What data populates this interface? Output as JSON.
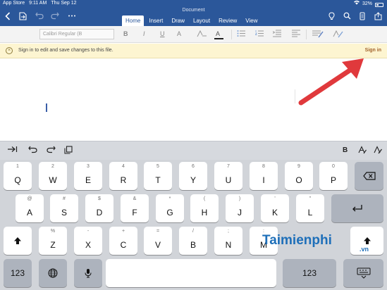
{
  "status_bar": {
    "back_app": "App Store",
    "time": "9:11 AM",
    "date": "Thu Sep 12",
    "battery": "32%"
  },
  "title_bar": {
    "document_title": "Document",
    "tabs": [
      "Home",
      "Insert",
      "Draw",
      "Layout",
      "Review",
      "View"
    ],
    "active_tab": "Home"
  },
  "ribbon": {
    "font_name": "Calibri Regular (B",
    "bold": "B",
    "italic": "I",
    "underline": "U",
    "format_brush": "A",
    "font_color": "A",
    "highlight": "A"
  },
  "signin_bar": {
    "message": "Sign in to edit and save changes to this file.",
    "link": "Sign in",
    "info_icon": "i"
  },
  "keyboard_toolbar": {
    "bold": "B"
  },
  "keyboard": {
    "row1": [
      {
        "main": "Q",
        "sub": "1"
      },
      {
        "main": "W",
        "sub": "2"
      },
      {
        "main": "E",
        "sub": "3"
      },
      {
        "main": "R",
        "sub": "4"
      },
      {
        "main": "T",
        "sub": "5"
      },
      {
        "main": "Y",
        "sub": "6"
      },
      {
        "main": "U",
        "sub": "7"
      },
      {
        "main": "I",
        "sub": "8"
      },
      {
        "main": "O",
        "sub": "9"
      },
      {
        "main": "P",
        "sub": "0"
      }
    ],
    "row2": [
      {
        "main": "A",
        "sub": "@"
      },
      {
        "main": "S",
        "sub": "#"
      },
      {
        "main": "D",
        "sub": "$"
      },
      {
        "main": "F",
        "sub": "&"
      },
      {
        "main": "G",
        "sub": "*"
      },
      {
        "main": "H",
        "sub": "("
      },
      {
        "main": "J",
        "sub": ")"
      },
      {
        "main": "K",
        "sub": "'"
      },
      {
        "main": "L",
        "sub": "\""
      }
    ],
    "row3": [
      {
        "main": "Z",
        "sub": "%"
      },
      {
        "main": "X",
        "sub": "-"
      },
      {
        "main": "C",
        "sub": "+"
      },
      {
        "main": "V",
        "sub": "="
      },
      {
        "main": "B",
        "sub": "/"
      },
      {
        "main": "N",
        "sub": ";"
      },
      {
        "main": "M",
        "sub": ":"
      }
    ],
    "numbers_key": "123",
    "numbers_key_right": "123"
  },
  "watermark": {
    "brand": "Taimienphi",
    "suffix": ".vn"
  },
  "colors": {
    "word_blue": "#2b579a",
    "signin_bg": "#fdf5d1",
    "arrow_red": "#e0393c",
    "keyboard_bg": "#d1d4d9"
  }
}
